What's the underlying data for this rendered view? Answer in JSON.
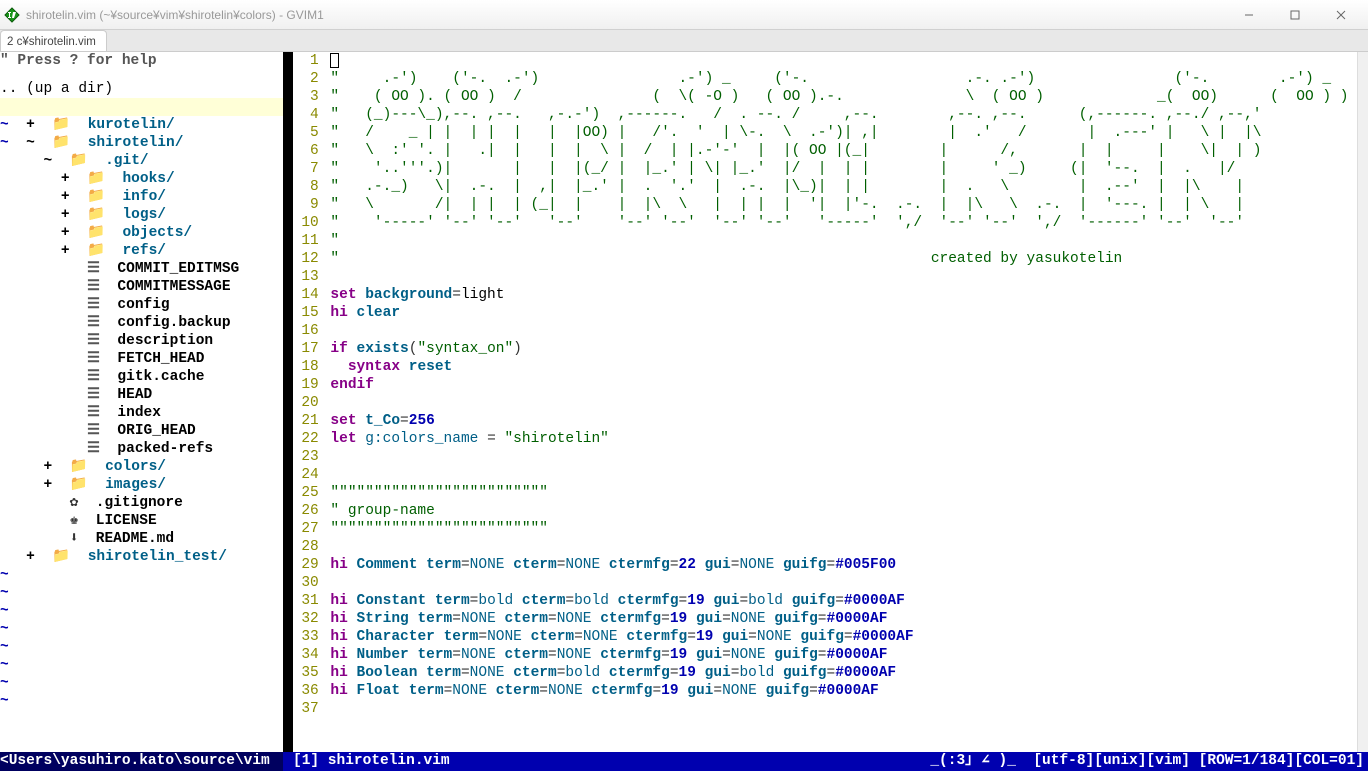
{
  "window": {
    "title": "shirotelin.vim (~¥source¥vim¥shirotelin¥colors) - GVIM1"
  },
  "tab": {
    "label": "2 c¥shirotelin.vim"
  },
  "sidebar": {
    "help": "\" Press ? for help",
    "updir": ".. (up a dir)",
    "current": "</yasuhiro.kato/source/vim/",
    "items": [
      {
        "indent": 0,
        "exp": "+",
        "icon": "folder",
        "name": "kurotelin/",
        "tilde": true
      },
      {
        "indent": 0,
        "exp": "~",
        "icon": "folder",
        "name": "shirotelin/",
        "tilde": true
      },
      {
        "indent": 1,
        "exp": "~",
        "icon": "folder",
        "name": ".git/",
        "tilde": false
      },
      {
        "indent": 2,
        "exp": "+",
        "icon": "folder",
        "name": "hooks/",
        "tilde": false
      },
      {
        "indent": 2,
        "exp": "+",
        "icon": "folder",
        "name": "info/",
        "tilde": false
      },
      {
        "indent": 2,
        "exp": "+",
        "icon": "folder",
        "name": "logs/",
        "tilde": false
      },
      {
        "indent": 2,
        "exp": "+",
        "icon": "folder",
        "name": "objects/",
        "tilde": false
      },
      {
        "indent": 2,
        "exp": "+",
        "icon": "folder",
        "name": "refs/",
        "tilde": false
      },
      {
        "indent": 2,
        "exp": " ",
        "icon": "file",
        "name": "COMMIT_EDITMSG",
        "tilde": false
      },
      {
        "indent": 2,
        "exp": " ",
        "icon": "file",
        "name": "COMMITMESSAGE",
        "tilde": false
      },
      {
        "indent": 2,
        "exp": " ",
        "icon": "file",
        "name": "config",
        "tilde": false
      },
      {
        "indent": 2,
        "exp": " ",
        "icon": "file",
        "name": "config.backup",
        "tilde": false
      },
      {
        "indent": 2,
        "exp": " ",
        "icon": "file",
        "name": "description",
        "tilde": false
      },
      {
        "indent": 2,
        "exp": " ",
        "icon": "file",
        "name": "FETCH_HEAD",
        "tilde": false
      },
      {
        "indent": 2,
        "exp": " ",
        "icon": "file",
        "name": "gitk.cache",
        "tilde": false
      },
      {
        "indent": 2,
        "exp": " ",
        "icon": "file",
        "name": "HEAD",
        "tilde": false
      },
      {
        "indent": 2,
        "exp": " ",
        "icon": "file",
        "name": "index",
        "tilde": false
      },
      {
        "indent": 2,
        "exp": " ",
        "icon": "file",
        "name": "ORIG_HEAD",
        "tilde": false
      },
      {
        "indent": 2,
        "exp": " ",
        "icon": "file",
        "name": "packed-refs",
        "tilde": false
      },
      {
        "indent": 1,
        "exp": "+",
        "icon": "folder",
        "name": "colors/",
        "tilde": false
      },
      {
        "indent": 1,
        "exp": "+",
        "icon": "folder",
        "name": "images/",
        "tilde": false
      },
      {
        "indent": 1,
        "exp": " ",
        "icon": "gear",
        "name": ".gitignore",
        "tilde": false
      },
      {
        "indent": 1,
        "exp": " ",
        "icon": "key",
        "name": "LICENSE",
        "tilde": false
      },
      {
        "indent": 1,
        "exp": " ",
        "icon": "down",
        "name": "README.md",
        "tilde": false
      },
      {
        "indent": 0,
        "exp": "+",
        "icon": "folder",
        "name": "shirotelin_test/",
        "tilde": false
      }
    ]
  },
  "editor": {
    "ascii": [
      "\"     .-')    ('-.  .-')                .-') _     ('-.                  .-. .-')                ('-.        .-') _  ",
      "\"    ( OO ). ( OO )  /               (  \\( -O )   ( OO ).-.              \\  ( OO )             _(  OO)      (  OO ) ) ",
      "\"   (_)---\\_),--. ,--.   ,-.-')  ,------.   /  . --. /     ,--.        ,--. ,--.      (,------. ,--./ ,--,'  ",
      "\"   /    _ | |  | |  |   |  |OO) |   /'.  '  | \\-.  \\  .-')| ,|        |  .'   /       |  .---' |   \\ |  |\\  ",
      "\"   \\  :' '. |   .|  |   |  |  \\ |  /  | |.-'-'  |  |( OO |(_|        |      /,       |  |     |    \\|  | ) ",
      "\"    '..'''.)|       |   |  |(_/ |  |_.' | \\| |_.'  |/  |  | |        |     ' _)     (|  '--.  |  .   |/  ",
      "\"   .-._)   \\|  .-.  |  ,|  |_.' |  .  '.'  |  .-.  |\\_)|  | |        |  .   \\        |  .--'  |  |\\    |   ",
      "\"   \\       /|  | |  | (_|  |    |  |\\  \\   |  | |  |  '|  |'-.  .-.  |  |\\   \\  .-.  |  '---. |  | \\   |   ",
      "\"    '-----' '--' '--'   '--'    '--' '--'  '--' '--'   '-----'  ',/  '--' '--'  ',/  '------' '--'  '--'   ",
      "\"",
      "\"                                                                    created by yasukotelin"
    ],
    "lines_start": 1,
    "lines_end": 37
  },
  "status": {
    "left": "<Users\\yasuhiro.kato\\source\\vim",
    "file": "[1] shirotelin.vim",
    "right": "_(:3｣ ∠ )_  [utf-8][unix][vim] [ROW=1/184][COL=01]"
  }
}
